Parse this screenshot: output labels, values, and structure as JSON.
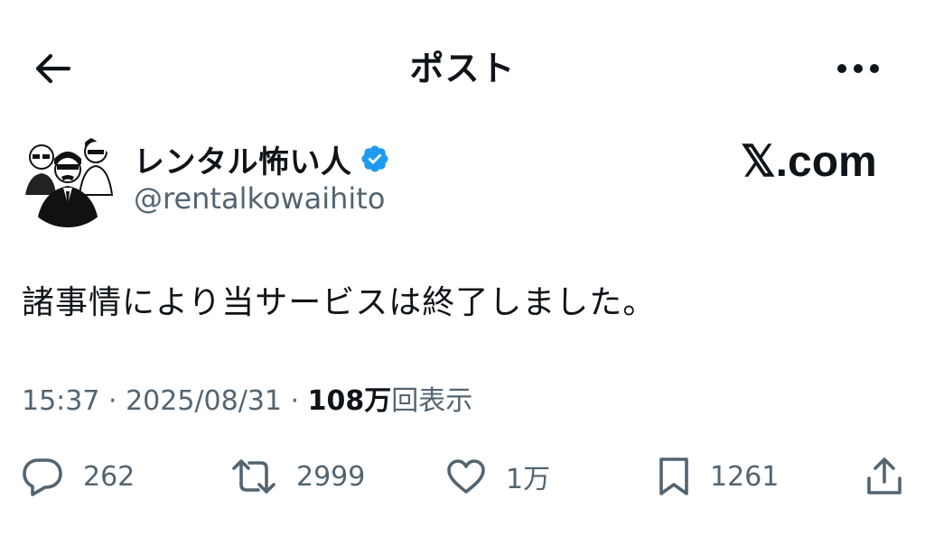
{
  "header": {
    "title": "ポスト",
    "back_icon": "arrow-left-icon",
    "more_icon": "more-horizontal-icon"
  },
  "author": {
    "display_name": "レンタル怖い人",
    "handle": "@rentalkowaihito",
    "verified": true,
    "verified_color": "#1d9bf0"
  },
  "watermark": "𝕏.com",
  "tweet": {
    "text": "諸事情により当サービスは終了しました。"
  },
  "meta": {
    "time": "15:37",
    "separator1": " · ",
    "date": "2025/08/31",
    "separator2": " · ",
    "views_count": "108万",
    "views_label": "回表示"
  },
  "actions": {
    "reply_count": "262",
    "retweet_count": "2999",
    "like_count": "1万",
    "bookmark_count": "1261"
  },
  "colors": {
    "text_primary": "#0f1419",
    "text_secondary": "#536471",
    "background": "#ffffff"
  }
}
